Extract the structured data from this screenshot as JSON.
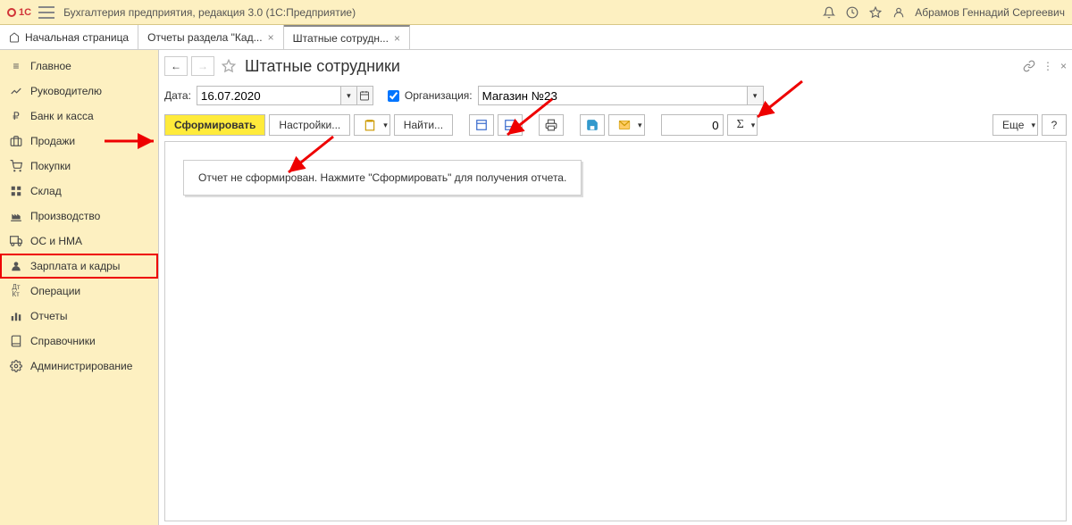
{
  "header": {
    "title": "Бухгалтерия предприятия, редакция 3.0  (1С:Предприятие)",
    "user": "Абрамов Геннадий Сергеевич"
  },
  "tabs": {
    "home": "Начальная страница",
    "reports": "Отчеты раздела \"Кад...",
    "staff": "Штатные сотрудн..."
  },
  "sidebar": [
    {
      "label": "Главное",
      "icon": "menu"
    },
    {
      "label": "Руководителю",
      "icon": "chart"
    },
    {
      "label": "Банк и касса",
      "icon": "ruble"
    },
    {
      "label": "Продажи",
      "icon": "briefcase"
    },
    {
      "label": "Покупки",
      "icon": "cart"
    },
    {
      "label": "Склад",
      "icon": "boxes"
    },
    {
      "label": "Производство",
      "icon": "factory"
    },
    {
      "label": "ОС и НМА",
      "icon": "truck"
    },
    {
      "label": "Зарплата и кадры",
      "icon": "person"
    },
    {
      "label": "Операции",
      "icon": "dtkt"
    },
    {
      "label": "Отчеты",
      "icon": "bars"
    },
    {
      "label": "Справочники",
      "icon": "book"
    },
    {
      "label": "Администрирование",
      "icon": "gear"
    }
  ],
  "page": {
    "title": "Штатные сотрудники",
    "date_label": "Дата:",
    "date_value": "16.07.2020",
    "org_label": "Организация:",
    "org_value": "Магазин №23"
  },
  "toolbar": {
    "generate": "Сформировать",
    "settings": "Настройки...",
    "find": "Найти...",
    "num_value": "0",
    "more": "Еще",
    "help": "?"
  },
  "content": {
    "placeholder": "Отчет не сформирован. Нажмите \"Сформировать\" для получения отчета."
  }
}
